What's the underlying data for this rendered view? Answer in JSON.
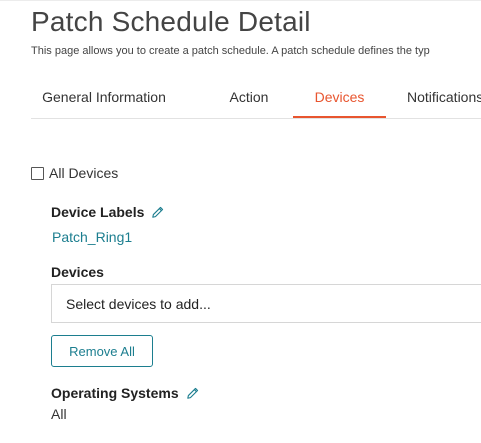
{
  "page": {
    "title": "Patch Schedule Detail",
    "description": "This page allows you to create a patch schedule. A patch schedule defines the typ"
  },
  "tabs": [
    {
      "label": "General Information",
      "active": false
    },
    {
      "label": "Action",
      "active": false
    },
    {
      "label": "Devices",
      "active": true
    },
    {
      "label": "Notifications",
      "active": false
    }
  ],
  "devices_tab": {
    "all_devices_label": "All Devices",
    "all_devices_checked": false,
    "device_labels": {
      "heading": "Device Labels",
      "value": "Patch_Ring1"
    },
    "devices": {
      "heading": "Devices",
      "placeholder": "Select devices to add..."
    },
    "remove_all_label": "Remove All",
    "operating_systems": {
      "heading": "Operating Systems",
      "value": "All"
    }
  },
  "colors": {
    "accent_active_tab": "#e8552f",
    "link_teal": "#1c7e8f"
  },
  "icons": {
    "edit": "pencil-icon"
  }
}
